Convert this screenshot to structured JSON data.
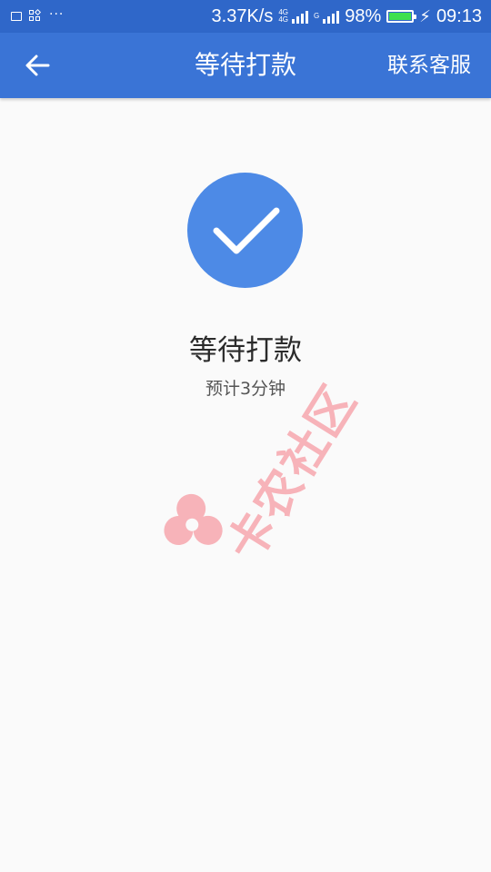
{
  "status_bar": {
    "network_speed": "3.37K/s",
    "sim1_label_top": "4G",
    "sim1_label_bottom": "4G",
    "sim2_label": "G",
    "battery_percent": "98%",
    "battery_level": 0.98,
    "time": "09:13",
    "dots": "···"
  },
  "app_bar": {
    "title": "等待打款",
    "action_label": "联系客服",
    "back_icon": "arrow-left-icon",
    "background_color": "#3a74d6"
  },
  "content": {
    "status_icon": "check-circle-icon",
    "status_title": "等待打款",
    "status_subtitle": "预计3分钟",
    "circle_color": "#4d8ae6"
  },
  "watermark": {
    "text": "卡农社区"
  }
}
